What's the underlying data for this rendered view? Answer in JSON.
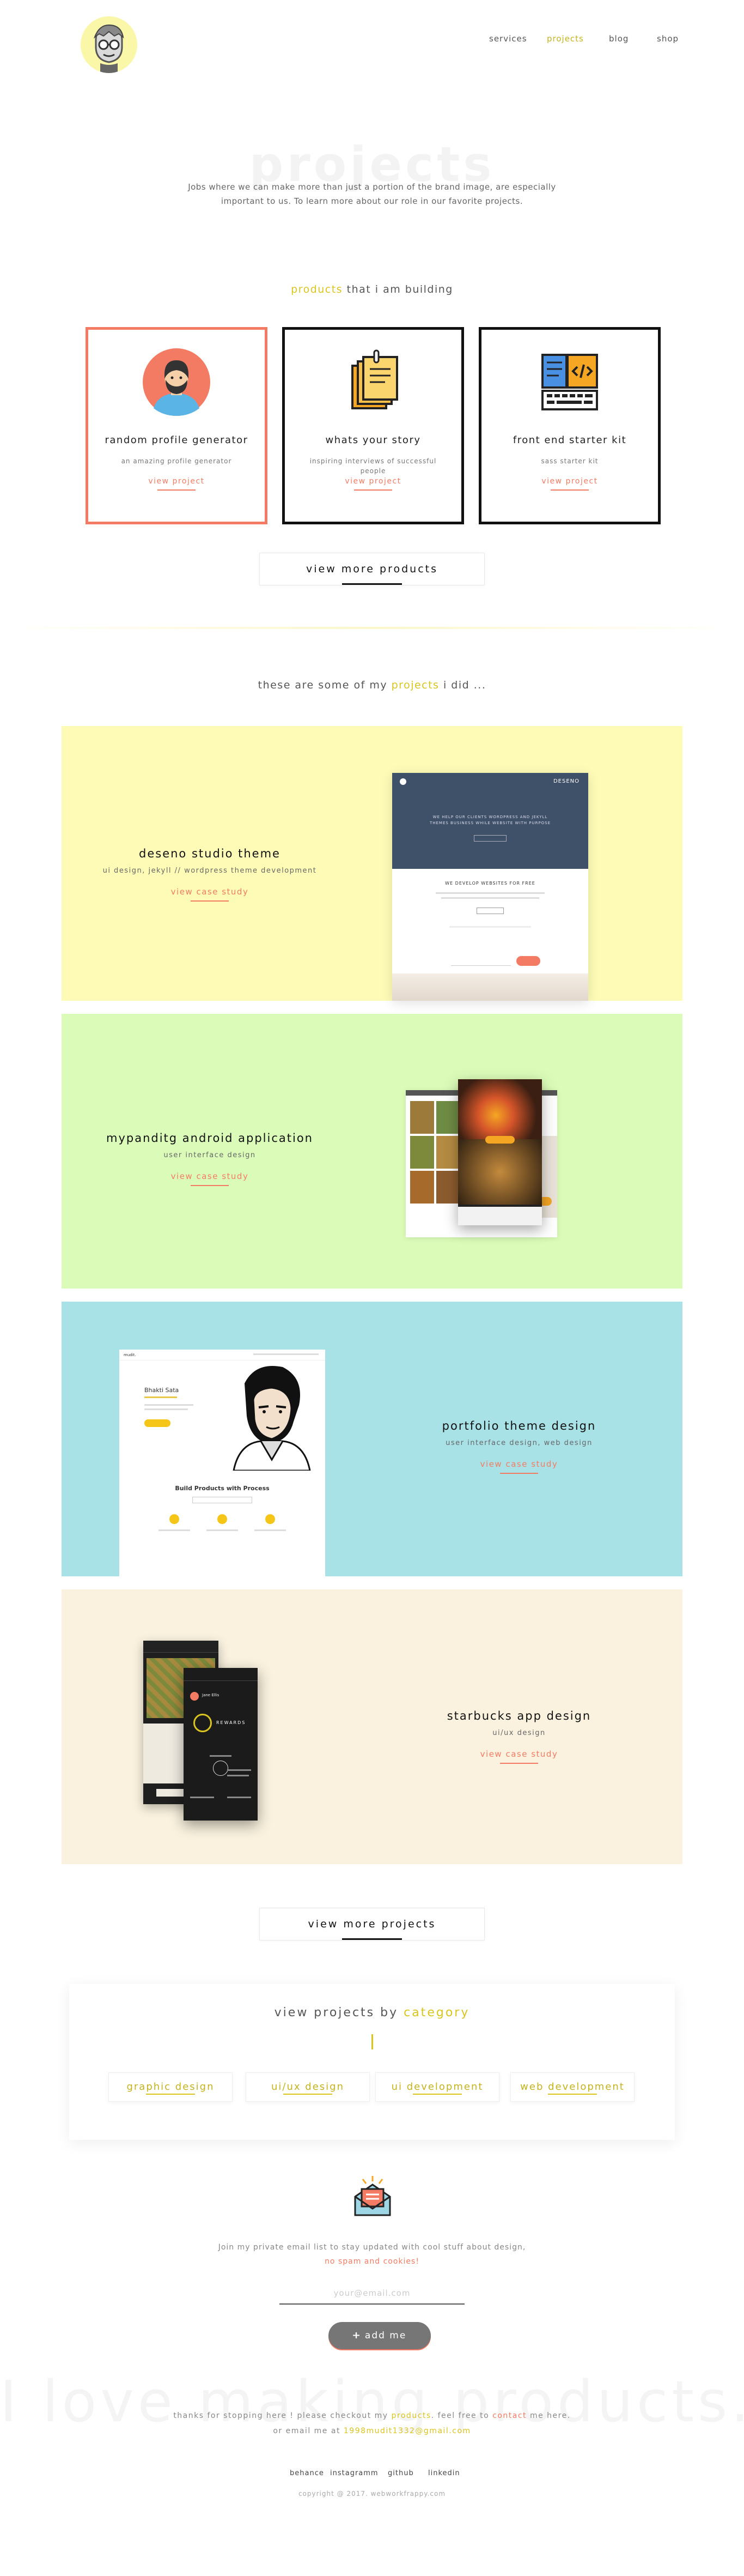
{
  "nav": {
    "items": [
      {
        "label": "services"
      },
      {
        "label": "projects"
      },
      {
        "label": "blog"
      },
      {
        "label": "shop"
      }
    ]
  },
  "hero": {
    "title": "projects",
    "subtitle": "Jobs where we can make more than just a portion of the brand image, are especially important to us. To learn more about our role in our favorite projects."
  },
  "products_section": {
    "title_accent": "products",
    "title_rest": " that i am building",
    "cards": [
      {
        "title": "random profile generator",
        "desc": "an amazing profile generator",
        "link": "view project",
        "icon": "avatar-icon"
      },
      {
        "title": "whats your story",
        "desc": "inspiring interviews of successful people",
        "link": "view project",
        "icon": "notes-icon"
      },
      {
        "title": "front end starter kit",
        "desc": "sass starter kit",
        "link": "view project",
        "icon": "code-icon"
      }
    ],
    "more_label": "view more products"
  },
  "projects_section": {
    "title_start": "these are some of my ",
    "title_accent": "projects",
    "title_end": " i did ...",
    "items": [
      {
        "title": "deseno studio theme",
        "subtitle": "ui design, jekyll // wordpress theme development",
        "link": "view case study",
        "bg": "#fdfbb6"
      },
      {
        "title": "mypanditg android application",
        "subtitle": "user interface design",
        "link": "view case study",
        "bg": "#dbfcb9"
      },
      {
        "title": "portfolio theme design",
        "subtitle": "user interface design, web design",
        "link": "view case study",
        "bg": "#a8e2e6"
      },
      {
        "title": "starbucks app design",
        "subtitle": "ui/ux design",
        "link": "view case study",
        "bg": "#faf2df"
      }
    ],
    "more_label": "view more projects"
  },
  "mockups": {
    "deseno_brand": "DESENO",
    "deseno_hero": "WE HELP OUR CLIENTS WORDPRESS AND JEKYLL THEMES BUSINESS WHILE WEBSITE WITH PURPOSE",
    "deseno_section": "WE DEVELOP WEBSITES FOR FREE",
    "portfolio_name": "Bhakti Sata",
    "portfolio_heading": "Build Products with Process",
    "starbucks_rewards": "REWARDS",
    "starbucks_user": "Jane Ellis"
  },
  "categories": {
    "title_start": "view projects by ",
    "title_accent": "category",
    "items": [
      {
        "label": "graphic design"
      },
      {
        "label": "ui/ux design"
      },
      {
        "label": "ui development"
      },
      {
        "label": "web development"
      }
    ]
  },
  "subscribe": {
    "line1": "Join my private email list to stay updated with cool stuff about design,",
    "line2": "no spam and cookies!",
    "placeholder": "your@email.com",
    "button_label": "add me"
  },
  "footer": {
    "big_text": "I love making products.",
    "thanks_start": "thanks for stopping here ! please checkout my ",
    "thanks_products": "products",
    "thanks_mid": ". feel free to ",
    "thanks_contact": "contact",
    "thanks_end": " me here.",
    "email_prefix": "or email me at ",
    "email": "1998mudit1332@gmail.com",
    "links": [
      {
        "label": "behance"
      },
      {
        "label": "instagramm"
      },
      {
        "label": "github"
      },
      {
        "label": "linkedin"
      }
    ],
    "copyright": "copyright @ 2017. webworkfrappy.com"
  },
  "colors": {
    "accent_yellow": "#d9c51e",
    "accent_coral": "#f47b63"
  }
}
